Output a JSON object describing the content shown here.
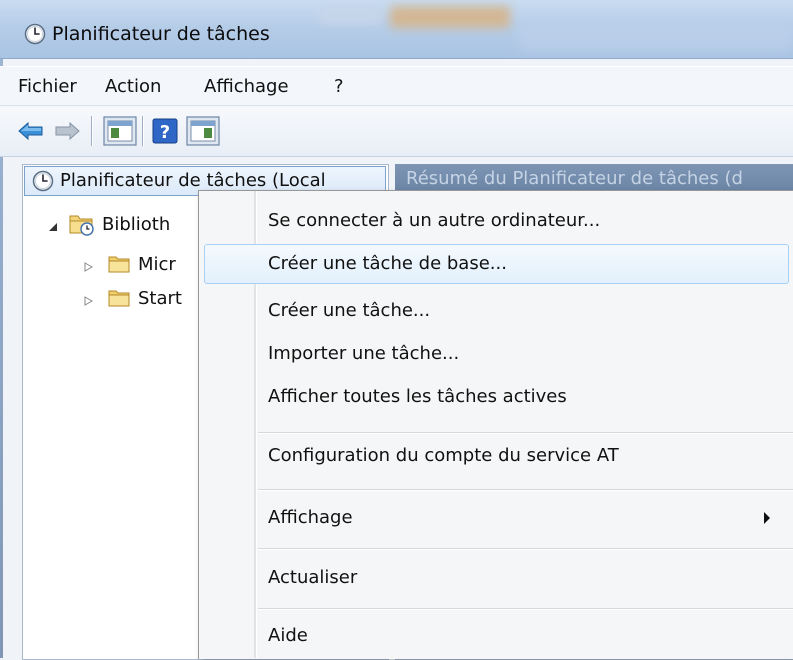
{
  "window": {
    "title": "Planificateur de tâches"
  },
  "menu": [
    "Fichier",
    "Action",
    "Affichage",
    "?"
  ],
  "toolbar": {
    "icons": [
      "back-arrow-icon",
      "forward-arrow-icon",
      "show-hide-console-tree-icon",
      "help-icon",
      "show-hide-action-pane-icon"
    ]
  },
  "tree": {
    "root": "Planificateur de tâches (Local",
    "library": "Biblioth",
    "children": [
      "Micr",
      "Start"
    ]
  },
  "right_pane": {
    "header": "Résumé du Planificateur de tâches (d"
  },
  "context_menu": {
    "items": [
      "Se connecter à un autre ordinateur...",
      "Créer une tâche de base...",
      "Créer une tâche...",
      "Importer une tâche...",
      "Afficher toutes les tâches actives",
      "Configuration du compte du service AT",
      "Affichage",
      "Actualiser",
      "Aide"
    ],
    "hovered_index": 1,
    "submenu_item": "Affichage"
  },
  "colors": {
    "accent": "#3a7bd5",
    "hover_border": "#a8d1f5",
    "folder": "#e8c458"
  }
}
